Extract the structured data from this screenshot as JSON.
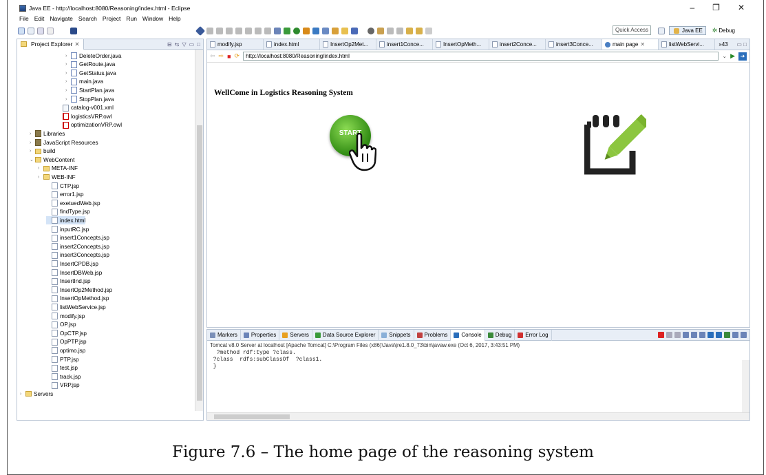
{
  "window": {
    "title": "Java EE - http://localhost:8080/Reasoning/index.html - Eclipse",
    "minimize": "–",
    "maximize": "❐",
    "close": "✕"
  },
  "menu": [
    "File",
    "Edit",
    "Navigate",
    "Search",
    "Project",
    "Run",
    "Window",
    "Help"
  ],
  "toolbar": {
    "quick_access": "Quick Access",
    "perspectives": [
      "Java EE",
      "Debug"
    ]
  },
  "explorer": {
    "tab_label": "Project Explorer",
    "close_glyph": "✕",
    "items": [
      {
        "label": "DeleteOrder.java",
        "type": "java",
        "arrow": "›"
      },
      {
        "label": "GetRoute.java",
        "type": "java",
        "arrow": "›"
      },
      {
        "label": "GetStatus.java",
        "type": "java",
        "arrow": "›"
      },
      {
        "label": "main.java",
        "type": "java",
        "arrow": "›"
      },
      {
        "label": "StartPlan.java",
        "type": "java",
        "arrow": "›"
      },
      {
        "label": "StopPlan.java",
        "type": "java",
        "arrow": "›"
      },
      {
        "label": "catalog-v001.xml",
        "type": "file",
        "arrow": ""
      },
      {
        "label": "logisticsVRP.owl",
        "type": "owl",
        "arrow": ""
      },
      {
        "label": "optimizationVRP.owl",
        "type": "owl",
        "arrow": ""
      },
      {
        "label": "Libraries",
        "type": "lib",
        "arrow": "›"
      },
      {
        "label": "JavaScript Resources",
        "type": "lib",
        "arrow": "›"
      },
      {
        "label": "build",
        "type": "folder",
        "arrow": "›"
      },
      {
        "label": "WebContent",
        "type": "folder",
        "arrow": "⌄"
      },
      {
        "label": "META-INF",
        "type": "folder",
        "arrow": "›"
      },
      {
        "label": "WEB-INF",
        "type": "folder",
        "arrow": "›"
      },
      {
        "label": "CTP.jsp",
        "type": "jsp",
        "arrow": ""
      },
      {
        "label": "error1.jsp",
        "type": "jsp",
        "arrow": ""
      },
      {
        "label": "exetuedWeb.jsp",
        "type": "jsp",
        "arrow": ""
      },
      {
        "label": "findType.jsp",
        "type": "jsp",
        "arrow": ""
      },
      {
        "label": "index.html",
        "type": "jsp",
        "arrow": "",
        "selected": true
      },
      {
        "label": "inputRC.jsp",
        "type": "jsp",
        "arrow": ""
      },
      {
        "label": "insert1Concepts.jsp",
        "type": "jsp",
        "arrow": ""
      },
      {
        "label": "insert2Concepts.jsp",
        "type": "jsp",
        "arrow": ""
      },
      {
        "label": "insert3Concepts.jsp",
        "type": "jsp",
        "arrow": ""
      },
      {
        "label": "InsertCPDB.jsp",
        "type": "jsp",
        "arrow": ""
      },
      {
        "label": "InsertDBWeb.jsp",
        "type": "jsp",
        "arrow": ""
      },
      {
        "label": "InsertInd.jsp",
        "type": "jsp",
        "arrow": ""
      },
      {
        "label": "InsertOp2Method.jsp",
        "type": "jsp",
        "arrow": ""
      },
      {
        "label": "InsertOpMethod.jsp",
        "type": "jsp",
        "arrow": ""
      },
      {
        "label": "listWebService.jsp",
        "type": "jsp",
        "arrow": ""
      },
      {
        "label": "modify.jsp",
        "type": "jsp",
        "arrow": ""
      },
      {
        "label": "OP.jsp",
        "type": "jsp",
        "arrow": ""
      },
      {
        "label": "OpCTP.jsp",
        "type": "jsp",
        "arrow": ""
      },
      {
        "label": "OpPTP.jsp",
        "type": "jsp",
        "arrow": ""
      },
      {
        "label": "optimo.jsp",
        "type": "jsp",
        "arrow": ""
      },
      {
        "label": "PTP.jsp",
        "type": "jsp",
        "arrow": ""
      },
      {
        "label": "test.jsp",
        "type": "jsp",
        "arrow": ""
      },
      {
        "label": "track.jsp",
        "type": "jsp",
        "arrow": ""
      },
      {
        "label": "VRP.jsp",
        "type": "jsp",
        "arrow": ""
      },
      {
        "label": "Servers",
        "type": "folder",
        "arrow": "›"
      }
    ]
  },
  "editor": {
    "tabs": [
      {
        "label": "modify.jsp"
      },
      {
        "label": "index.html"
      },
      {
        "label": "InsertOp2Met..."
      },
      {
        "label": "insert1Conce..."
      },
      {
        "label": "InsertOpMeth..."
      },
      {
        "label": "insert2Conce..."
      },
      {
        "label": "insert3Conce..."
      },
      {
        "label": "main page",
        "active": true
      },
      {
        "label": "listWebServi..."
      }
    ],
    "overflow": "»43",
    "url": "http://localhost:8080/Reasoning/index.html",
    "page_heading": "WellCome in Logistics Reasoning System",
    "start_label": "START"
  },
  "console": {
    "tabs": [
      "Markers",
      "Properties",
      "Servers",
      "Data Source Explorer",
      "Snippets",
      "Problems",
      "Console",
      "Debug",
      "Error Log"
    ],
    "active_tab": "Console",
    "status": "Tomcat v8.0 Server at localhost [Apache Tomcat] C:\\Program Files (x86)\\Java\\jre1.8.0_73\\bin\\javaw.exe (Oct 6, 2017, 3:43:51 PM)",
    "lines": [
      "  ?method rdf:type ?class.",
      " ?class  rdfs:subClassOf  ?class1.",
      " }"
    ]
  },
  "caption": "Figure 7.6 – The home page of the reasoning system"
}
